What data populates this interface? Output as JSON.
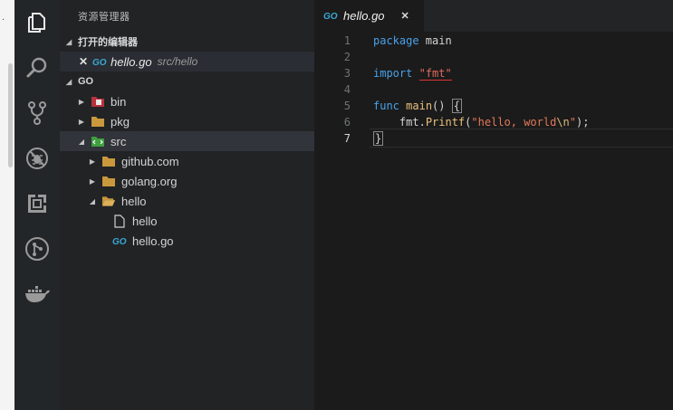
{
  "left_strip": {
    "dot": "·"
  },
  "activity_bar": {
    "icons": [
      "files-icon",
      "search-icon",
      "source-control-icon",
      "debug-icon",
      "extensions-icon",
      "git-graph-icon",
      "docker-icon"
    ]
  },
  "sidebar": {
    "title": "资源管理器",
    "open_editors": {
      "header": "打开的编辑器",
      "items": [
        {
          "close": "✕",
          "name": "hello.go",
          "path": "src/hello"
        }
      ]
    },
    "workspace": {
      "header": "GO",
      "tree": [
        {
          "label": "bin",
          "twisty": "▶",
          "icon": "bin-folder-icon"
        },
        {
          "label": "pkg",
          "twisty": "▶",
          "icon": "folder-icon"
        },
        {
          "label": "src",
          "twisty": "◢",
          "icon": "src-folder-icon"
        },
        {
          "label": "github.com",
          "twisty": "▶",
          "icon": "folder-icon"
        },
        {
          "label": "golang.org",
          "twisty": "▶",
          "icon": "folder-icon"
        },
        {
          "label": "hello",
          "twisty": "◢",
          "icon": "folder-open-icon"
        },
        {
          "label": "hello",
          "twisty": "",
          "icon": "file-icon"
        },
        {
          "label": "hello.go",
          "twisty": "",
          "icon": "go-file-icon"
        }
      ]
    }
  },
  "editor": {
    "tab": {
      "name": "hello.go",
      "close": "✕"
    },
    "line_numbers": [
      "1",
      "2",
      "3",
      "4",
      "5",
      "6",
      "7"
    ],
    "lines": [
      {
        "kw": "package",
        "rest": " main"
      },
      {},
      {
        "kw": "import",
        "sp": " ",
        "str": "\"fmt\""
      },
      {},
      {
        "kw": "func",
        "sp": " ",
        "fn": "main",
        "rest": "() ",
        "brace": "{"
      },
      {
        "indent": "    ",
        "obj": "fmt.",
        "fn": "Printf",
        "open": "(",
        "str": "\"hello, world",
        "esc": "\\n",
        "str2": "\"",
        "close": ");"
      },
      {
        "brace": "}"
      }
    ]
  },
  "colors": {
    "keyword": "#4aa0e8",
    "string": "#e3785a",
    "function": "#e8c07a",
    "go_blue": "#3aa9d4"
  }
}
